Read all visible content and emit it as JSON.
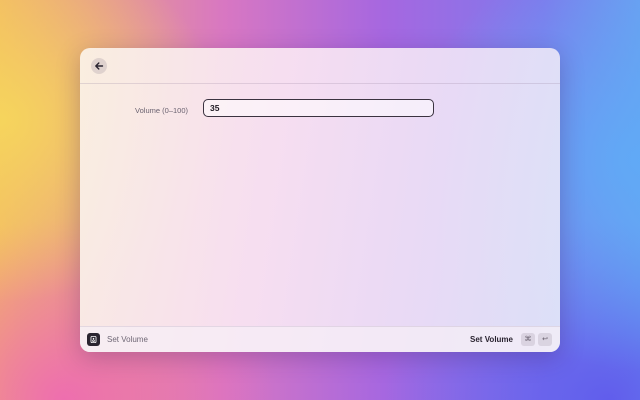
{
  "header": {
    "back_icon": "arrow-left-icon"
  },
  "form": {
    "volume_label": "Volume (0–100)",
    "volume_value": "35"
  },
  "footer": {
    "extension_icon": "extension-icon",
    "command_title": "Set Volume",
    "primary_action_label": "Set Volume",
    "shortcut_keys": [
      "⌘",
      "↩"
    ]
  }
}
